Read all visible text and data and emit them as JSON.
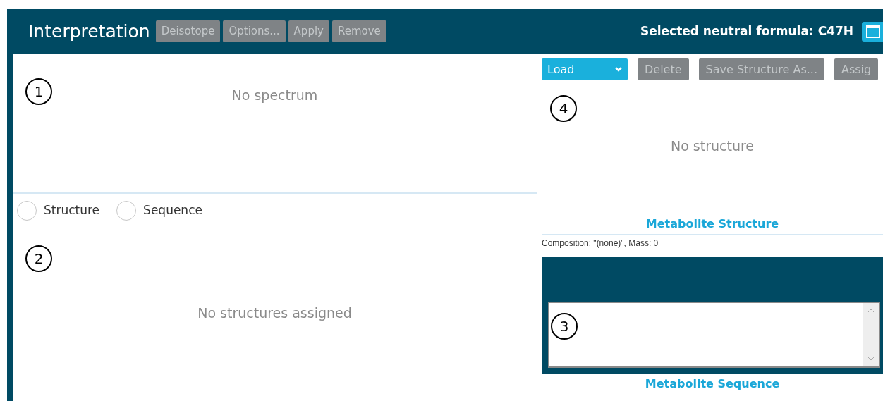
{
  "header": {
    "title": "Interpretation",
    "buttons": [
      {
        "label": "Deisotope",
        "disabled": true
      },
      {
        "label": "Options...",
        "disabled": true
      },
      {
        "label": "Apply",
        "disabled": true
      },
      {
        "label": "Remove",
        "disabled": true
      }
    ],
    "formula": "Selected neutral formula: C47H"
  },
  "spectrum": {
    "callout": "1",
    "message": "No spectrum"
  },
  "assignment": {
    "options": [
      {
        "label": "Structure",
        "selected": false
      },
      {
        "label": "Sequence",
        "selected": false
      }
    ],
    "callout": "2",
    "message": "No structures assigned"
  },
  "structure": {
    "toolbar": [
      {
        "kind": "dropdown",
        "label": "Load",
        "disabled": false
      },
      {
        "kind": "button",
        "label": "Delete",
        "disabled": true
      },
      {
        "kind": "button",
        "label": "Save Structure As...",
        "disabled": true
      },
      {
        "kind": "button",
        "label": "Assig",
        "disabled": true
      }
    ],
    "callout": "4",
    "message": "No structure",
    "caption": "Metabolite Structure",
    "composition": "Composition: \"(none)\", Mass: 0"
  },
  "sequence": {
    "callout": "3",
    "caption": "Metabolite Sequence"
  }
}
